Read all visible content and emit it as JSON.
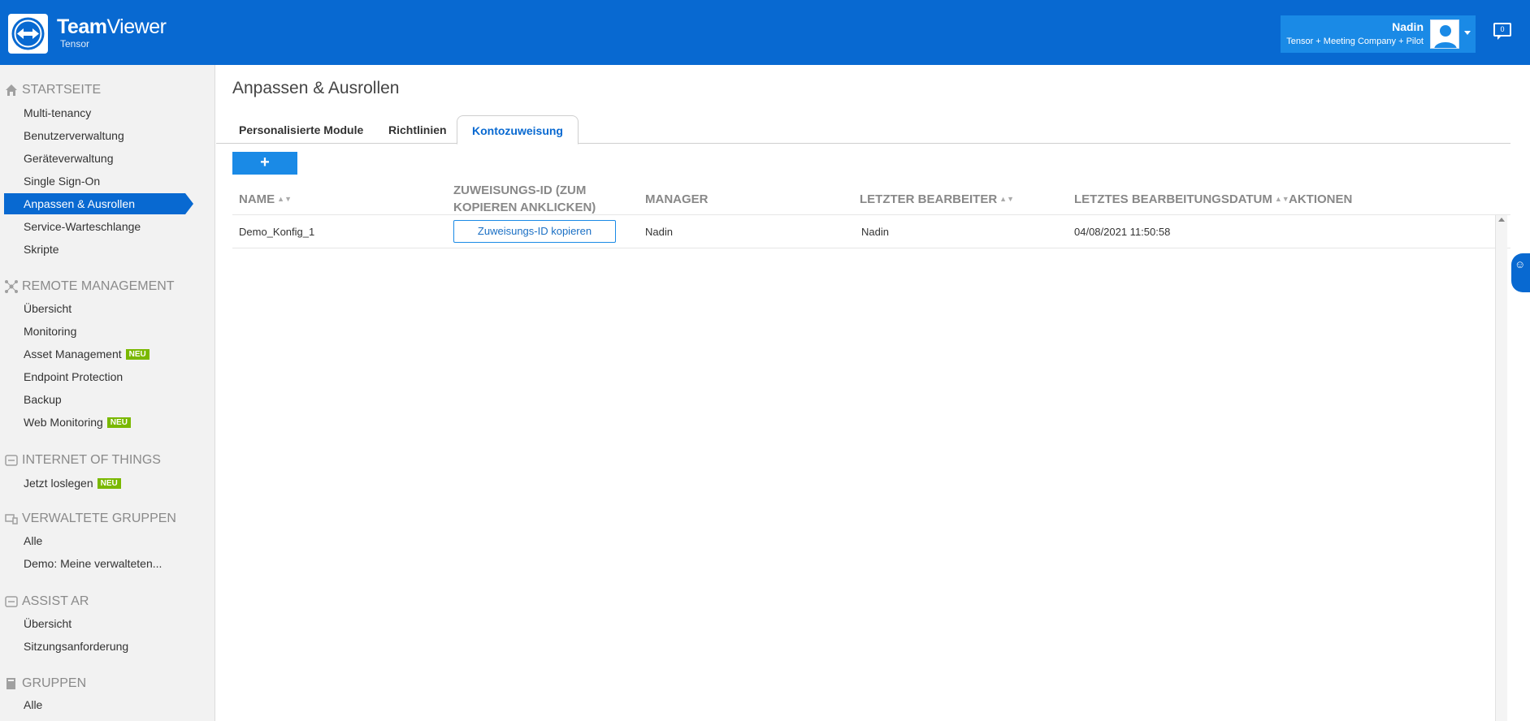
{
  "brand": {
    "name_bold": "Team",
    "name_light": "Viewer",
    "subtitle": "Tensor"
  },
  "user": {
    "name": "Nadin",
    "org": "Tensor + Meeting Company + Pilot"
  },
  "notifications": {
    "count": "0"
  },
  "sidebar": {
    "sections": [
      {
        "title": "STARTSEITE",
        "icon": "home-icon",
        "items": [
          "Multi-tenancy",
          "Benutzerverwaltung",
          "Geräteverwaltung",
          "Single Sign-On",
          "Anpassen & Ausrollen",
          "Service-Warteschlange",
          "Skripte"
        ]
      },
      {
        "title": "REMOTE MANAGEMENT",
        "icon": "remote-management-icon",
        "items": [
          "Übersicht",
          "Monitoring",
          "Asset Management",
          "Endpoint Protection",
          "Backup",
          "Web Monitoring"
        ]
      },
      {
        "title": "INTERNET OF THINGS",
        "icon": "iot-icon",
        "items": [
          "Jetzt loslegen"
        ]
      },
      {
        "title": "VERWALTETE GRUPPEN",
        "icon": "managed-groups-icon",
        "items": [
          "Alle",
          "Demo: Meine verwalteten..."
        ]
      },
      {
        "title": "ASSIST AR",
        "icon": "assist-ar-icon",
        "items": [
          "Übersicht",
          "Sitzungsanforderung"
        ]
      },
      {
        "title": "GRUPPEN",
        "icon": "groups-icon",
        "items": [
          "Alle"
        ]
      }
    ],
    "active_item": "Anpassen & Ausrollen",
    "badge_label": "NEU"
  },
  "main": {
    "title": "Anpassen & Ausrollen",
    "tabs": [
      "Personalisierte Module",
      "Richtlinien",
      "Kontozuweisung"
    ],
    "active_tab": "Kontozuweisung",
    "add_label": "+",
    "table": {
      "columns": [
        "NAME",
        "ZUWEISUNGS-ID (ZUM",
        "KOPIEREN ANKLICKEN)",
        "MANAGER",
        "LETZTER BEARBEITER",
        "LETZTES BEARBEITUNGSDATUM",
        "AKTIONEN"
      ],
      "rows": [
        {
          "name": "Demo_Konfig_1",
          "copy_label": "Zuweisungs-ID kopieren",
          "manager": "Nadin",
          "last_editor": "Nadin",
          "last_date": "04/08/2021 11:50:58"
        }
      ]
    }
  },
  "colors": {
    "primary": "#0869d1",
    "accent": "#1a8ae6",
    "badge": "#7ab800"
  }
}
